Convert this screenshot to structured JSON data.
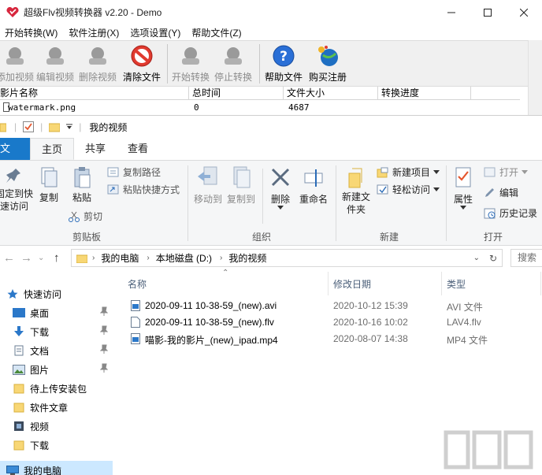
{
  "app": {
    "title": "超级Flv视频转换器 v2.20 - Demo",
    "menus": [
      "开始转换(W)",
      "软件注册(X)",
      "选项设置(Y)",
      "帮助文件(Z)"
    ],
    "toolbar": {
      "add_video": "添加视频",
      "edit_video": "编辑视频",
      "delete_video": "删除视频",
      "clear_files": "清除文件",
      "start_convert": "开始转换",
      "stop_convert": "停止转换",
      "help_file": "帮助文件",
      "buy_register": "购买注册"
    },
    "columns": [
      "影片名称",
      "总时间",
      "文件大小",
      "转换进度"
    ],
    "rows": [
      {
        "name": "watermark.png",
        "duration": "0",
        "size": "4687",
        "progress": ""
      }
    ]
  },
  "explorer": {
    "title": "我的视频",
    "tabs": [
      "文件",
      "主页",
      "共享",
      "查看"
    ],
    "ribbon": {
      "pin_quick_access": "固定到快速访问",
      "copy": "复制",
      "paste": "粘贴",
      "copy_path": "复制路径",
      "paste_shortcut": "粘贴快捷方式",
      "cut": "剪切",
      "clipboard_group": "剪贴板",
      "move_to": "移动到",
      "copy_to": "复制到",
      "delete": "删除",
      "rename": "重命名",
      "organize_group": "组织",
      "new_folder": "新建文件夹",
      "new_item": "新建项目",
      "easy_access": "轻松访问",
      "new_group": "新建",
      "properties": "属性",
      "open": "打开",
      "edit": "编辑",
      "history": "历史记录",
      "open_group": "打开"
    },
    "breadcrumb": [
      "我的电脑",
      "本地磁盘 (D:)",
      "我的视频"
    ],
    "search_placeholder": "搜索",
    "nav": {
      "quick_access": "快速访问",
      "desktop": "桌面",
      "downloads": "下载",
      "documents": "文档",
      "pictures": "图片",
      "pending": "待上传安装包",
      "articles": "软件文章",
      "videos": "视频",
      "download2": "下载",
      "this_pc": "我的电脑"
    },
    "columns": {
      "name": "名称",
      "date": "修改日期",
      "type": "类型"
    },
    "files": [
      {
        "name": "2020-09-11 10-38-59_(new).avi",
        "date": "2020-10-12 15:39",
        "type": "AVI 文件"
      },
      {
        "name": "2020-09-11 10-38-59_(new).flv",
        "date": "2020-10-16 10:02",
        "type": "LAV4.flv"
      },
      {
        "name": "喵影-我的影片_(new)_ipad.mp4",
        "date": "2020-08-07 14:38",
        "type": "MP4 文件"
      }
    ]
  },
  "colors": {
    "accent": "#1979ca",
    "selected": "#cce8ff",
    "folder": "#f8d775"
  }
}
